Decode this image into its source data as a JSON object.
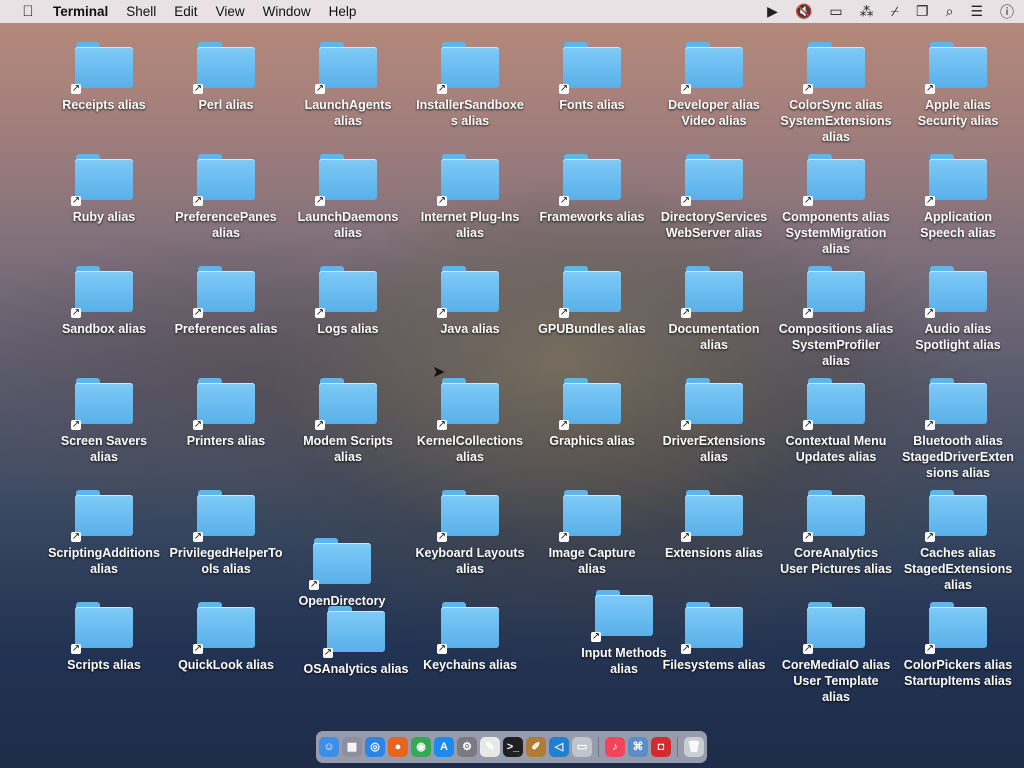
{
  "menubar": {
    "apple": "",
    "app_name": "Terminal",
    "items": [
      "Shell",
      "Edit",
      "View",
      "Window",
      "Help"
    ],
    "status_icons": [
      "play-icon",
      "mute-icon",
      "display-icon",
      "dot-icon",
      "wifi-off-icon",
      "windows-icon",
      "search-icon",
      "control-center-icon",
      "siri-icon"
    ]
  },
  "icons": [
    {
      "label": "Receipts alias"
    },
    {
      "label": "Perl alias"
    },
    {
      "label": "LaunchAgents\nalias"
    },
    {
      "label": "InstallerSandboxe\ns alias"
    },
    {
      "label": "Fonts alias"
    },
    {
      "label": "Developer alias\nVideo alias"
    },
    {
      "label": "ColorSync alias\nSystemExtensions\nalias"
    },
    {
      "label": "Apple alias\nSecurity alias"
    },
    {
      "label": "Ruby alias"
    },
    {
      "label": "PreferencePanes\nalias"
    },
    {
      "label": "LaunchDaemons\nalias"
    },
    {
      "label": "Internet Plug-Ins\nalias"
    },
    {
      "label": "Frameworks alias"
    },
    {
      "label": "DirectoryServices\nWebServer alias"
    },
    {
      "label": "Components alias\nSystemMigration\nalias"
    },
    {
      "label": "Application\nSpeech alias"
    },
    {
      "label": "Sandbox alias"
    },
    {
      "label": "Preferences alias"
    },
    {
      "label": "Logs alias"
    },
    {
      "label": "Java alias"
    },
    {
      "label": "GPUBundles alias"
    },
    {
      "label": "Documentation\nalias"
    },
    {
      "label": "Compositions alias\nSystemProfiler\nalias"
    },
    {
      "label": "Audio alias\nSpotlight alias"
    },
    {
      "label": "Screen Savers\nalias"
    },
    {
      "label": "Printers alias"
    },
    {
      "label": "Modem Scripts\nalias"
    },
    {
      "label": "KernelCollections\nalias"
    },
    {
      "label": "Graphics alias"
    },
    {
      "label": "DriverExtensions\nalias"
    },
    {
      "label": "Contextual Menu\nUpdates alias"
    },
    {
      "label": "Bluetooth alias\nStagedDriverExten\nsions alias"
    },
    {
      "label": "ScriptingAdditions\nalias"
    },
    {
      "label": "PrivilegedHelperTo\nols alias"
    },
    {
      "label": "OpenDirectory"
    },
    {
      "label": "Keyboard Layouts\nalias"
    },
    {
      "label": "Image Capture\nalias"
    },
    {
      "label": "Extensions alias"
    },
    {
      "label": "CoreAnalytics\nUser Pictures alias"
    },
    {
      "label": "Caches alias\nStagedExtensions\nalias"
    },
    {
      "label": "Scripts alias"
    },
    {
      "label": "QuickLook alias"
    },
    {
      "label": "OSAnalytics alias"
    },
    {
      "label": "Keychains alias"
    },
    {
      "label": "Input Methods\nalias"
    },
    {
      "label": "Filesystems alias"
    },
    {
      "label": "CoreMediaIO alias\nUser Template\nalias"
    },
    {
      "label": "ColorPickers alias\nStartupItems alias"
    }
  ],
  "dock": {
    "apps": [
      {
        "name": "finder-icon",
        "glyph": "☺",
        "color": "#3d8ee8"
      },
      {
        "name": "launchpad-icon",
        "glyph": "▦",
        "color": "#8f8f9f"
      },
      {
        "name": "safari-icon",
        "glyph": "◎",
        "color": "#2e84e6"
      },
      {
        "name": "firefox-icon",
        "glyph": "●",
        "color": "#e7641f"
      },
      {
        "name": "chrome-icon",
        "glyph": "◉",
        "color": "#36a853"
      },
      {
        "name": "app-store-icon",
        "glyph": "A",
        "color": "#1d8af2"
      },
      {
        "name": "system-preferences-icon",
        "glyph": "⚙",
        "color": "#7a7a80"
      },
      {
        "name": "textedit-icon",
        "glyph": "✎",
        "color": "#e8e8e8"
      },
      {
        "name": "terminal-icon",
        "glyph": ">_",
        "color": "#202020"
      },
      {
        "name": "script-editor-icon",
        "glyph": "✐",
        "color": "#b07b34"
      },
      {
        "name": "vscode-icon",
        "glyph": "◁",
        "color": "#1f7fd1"
      },
      {
        "name": "disk-icon",
        "glyph": "▭",
        "color": "#bfc5cc"
      },
      {
        "name": "music-icon",
        "glyph": "♪",
        "color": "#f2445a"
      },
      {
        "name": "network-icon",
        "glyph": "⌘",
        "color": "#5b8dc9"
      },
      {
        "name": "photo-booth-icon",
        "glyph": "◘",
        "color": "#d12b2b"
      },
      {
        "name": "trash-icon",
        "glyph": "🗑",
        "color": "#c9cdd4"
      }
    ]
  }
}
